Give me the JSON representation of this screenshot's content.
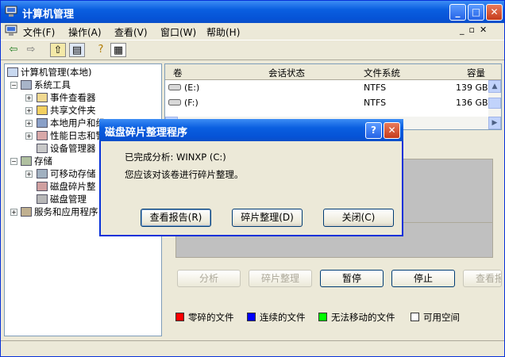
{
  "window": {
    "title": "计算机管理"
  },
  "menu": [
    "文件(F)",
    "操作(A)",
    "查看(V)",
    "窗口(W)",
    "帮助(H)"
  ],
  "tree": {
    "root": "计算机管理(本地)",
    "system_tools": "系统工具",
    "event_viewer": "事件查看器",
    "shared_folders": "共享文件夹",
    "local_users": "本地用户和组",
    "perf_logs": "性能日志和警",
    "device_manager": "设备管理器",
    "storage": "存储",
    "removable": "可移动存储",
    "defrag": "磁盘碎片整",
    "disk_mgmt": "磁盘管理",
    "services": "服务和应用程序"
  },
  "volumes": {
    "columns": [
      "卷",
      "会话状态",
      "文件系统",
      "容量"
    ],
    "rows": [
      {
        "vol": "(E:)",
        "status": "",
        "fs": "NTFS",
        "size": "139 GB"
      },
      {
        "vol": "(F:)",
        "status": "",
        "fs": "NTFS",
        "size": "136 GB"
      }
    ]
  },
  "actions": {
    "analyze": "分析",
    "defrag": "碎片整理",
    "pause": "暂停",
    "stop": "停止",
    "report": "查看报"
  },
  "legend": [
    {
      "label": "零碎的文件",
      "color": "#ff0000"
    },
    {
      "label": "连续的文件",
      "color": "#0000ff"
    },
    {
      "label": "无法移动的文件",
      "color": "#00ff00"
    },
    {
      "label": "可用空间",
      "color": "#ffffff"
    }
  ],
  "dialog": {
    "title": "磁盘碎片整理程序",
    "line1": "已完成分析: WINXP (C:)",
    "line2": "您应该对该卷进行碎片整理。",
    "btn_report": "查看报告(R)",
    "btn_defrag": "碎片整理(D)",
    "btn_close": "关闭(C)"
  }
}
